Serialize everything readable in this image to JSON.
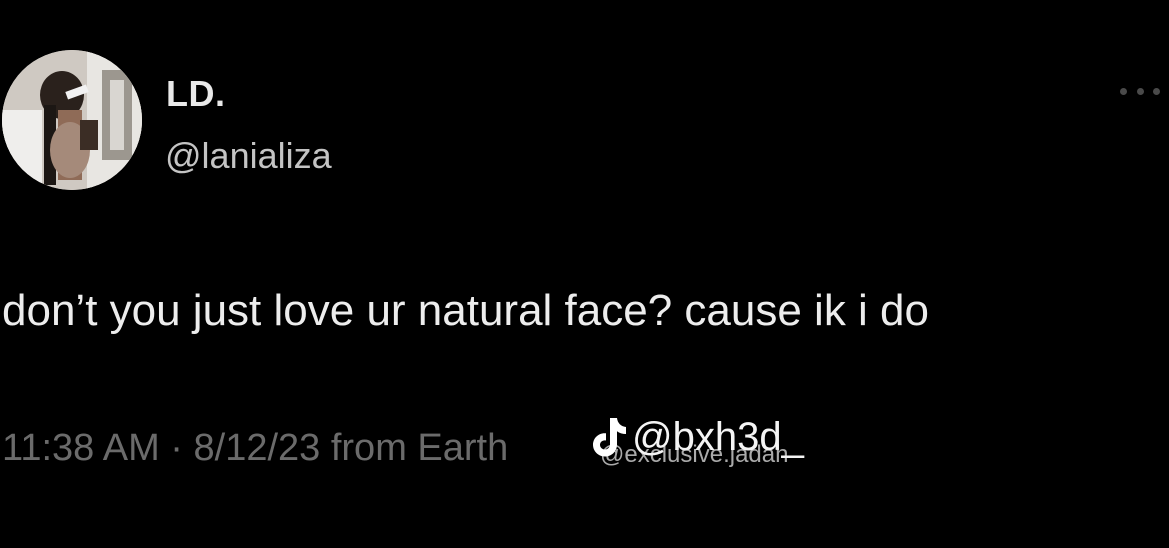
{
  "tweet": {
    "avatar_icon": "profile-photo",
    "display_name": "LD.",
    "handle": "@lanializa",
    "more_icon": "ellipsis-icon",
    "text": "don’t you just love ur natural face? cause ik i do",
    "timestamp": "11:38 AM · 8/12/23 from Earth"
  },
  "watermark": {
    "icon": "tiktok-icon",
    "primary_handle": "@bxh3d_",
    "secondary_handle": "@exclusive.jadah"
  },
  "colors": {
    "background": "#000000",
    "text": "#ededed",
    "secondary_text": "#c4c4c4",
    "meta_text": "#6b6b6b"
  }
}
